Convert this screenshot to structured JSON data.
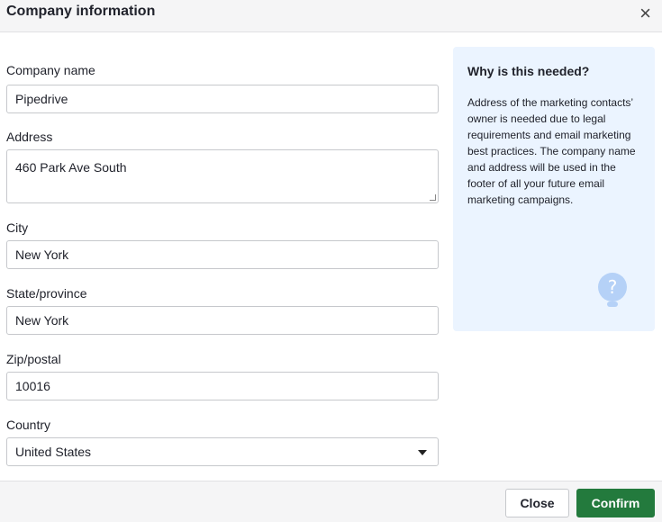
{
  "dialog": {
    "title": "Company information",
    "close_icon": "×"
  },
  "form": {
    "company_name": {
      "label": "Company name",
      "value": "Pipedrive"
    },
    "address": {
      "label": "Address",
      "value": "460 Park Ave South"
    },
    "city": {
      "label": "City",
      "value": "New York"
    },
    "state": {
      "label": "State/province",
      "value": "New York"
    },
    "zip": {
      "label": "Zip/postal",
      "value": "10016"
    },
    "country": {
      "label": "Country",
      "value": "United States"
    }
  },
  "info": {
    "title": "Why is this needed?",
    "text": "Address of the marketing contacts’ owner is needed due to legal requirements and email marketing best practices. The company name and address will be used in the footer of all your future email marketing campaigns.",
    "icon": "lightbulb-question-icon",
    "icon_color": "#b5d1f7"
  },
  "footer": {
    "close_label": "Close",
    "confirm_label": "Confirm",
    "confirm_color": "#237a3d"
  }
}
